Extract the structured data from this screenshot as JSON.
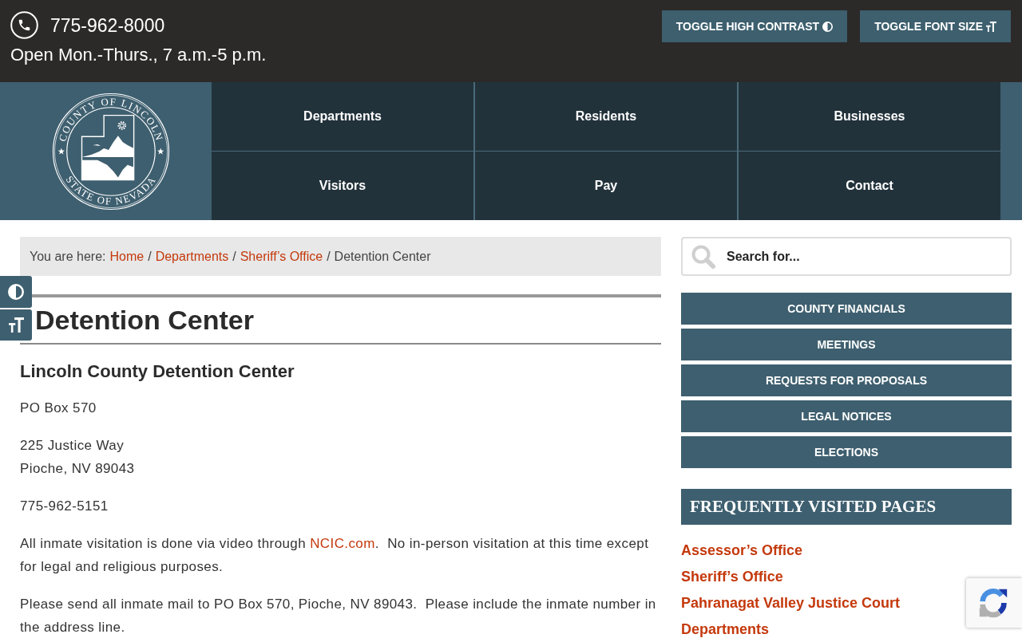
{
  "top_bar": {
    "phone": "775-962-8000",
    "hours": "Open Mon.-Thurs., 7 a.m.-5 p.m.",
    "buttons": [
      "TOGGLE HIGH CONTRAST",
      "TOGGLE FONT SIZE"
    ]
  },
  "logo": {
    "top_text": "COUNTY OF LINCOLN",
    "bottom_text": "STATE OF NEVADA"
  },
  "nav": [
    "Departments",
    "Residents",
    "Businesses",
    "Visitors",
    "Pay",
    "Contact"
  ],
  "breadcrumb": {
    "prefix": "You are here:",
    "items": [
      {
        "kind": "link",
        "text": "Home"
      },
      {
        "kind": "separator",
        "text": "/"
      },
      {
        "kind": "link",
        "text": "Departments"
      },
      {
        "kind": "separator",
        "text": "/"
      },
      {
        "kind": "link",
        "text": "Sheriff’s Office"
      },
      {
        "kind": "separator",
        "text": "/"
      },
      {
        "kind": "current",
        "text": "Detention Center"
      }
    ]
  },
  "page_title": "Detention Center",
  "content": {
    "heading": "Lincoln County Detention Center",
    "paragraphs": [
      {
        "kind": "plain",
        "text": "PO Box 570"
      },
      {
        "kind": "plain",
        "text": "225 Justice Way\nPioche, NV 89043"
      },
      {
        "kind": "plain",
        "text": "775-962-5151"
      },
      {
        "kind": "linked",
        "parts": [
          {
            "kind": "text",
            "text": "All inmate visitation is done via video through "
          },
          {
            "kind": "link",
            "text": "NCIC.com"
          },
          {
            "kind": "text",
            "text": ".  No in-person visitation at this time except for legal and religious purposes."
          }
        ]
      },
      {
        "kind": "plain",
        "text": "Please send all inmate mail to PO Box 570, Pioche, NV 89043.  Please include the inmate number in the address line."
      }
    ]
  },
  "sidebar": {
    "search": {
      "placeholder": "Search for..."
    },
    "buttons": [
      "COUNTY FINANCIALS",
      "MEETINGS",
      "REQUESTS FOR PROPOSALS",
      "LEGAL NOTICES",
      "ELECTIONS"
    ],
    "frequently_visited": {
      "title": "FREQUENTLY VISITED PAGES",
      "links": [
        "Assessor’s Office",
        "Sheriff’s Office",
        "Pahranagat Valley Justice Court",
        "Departments"
      ]
    }
  }
}
